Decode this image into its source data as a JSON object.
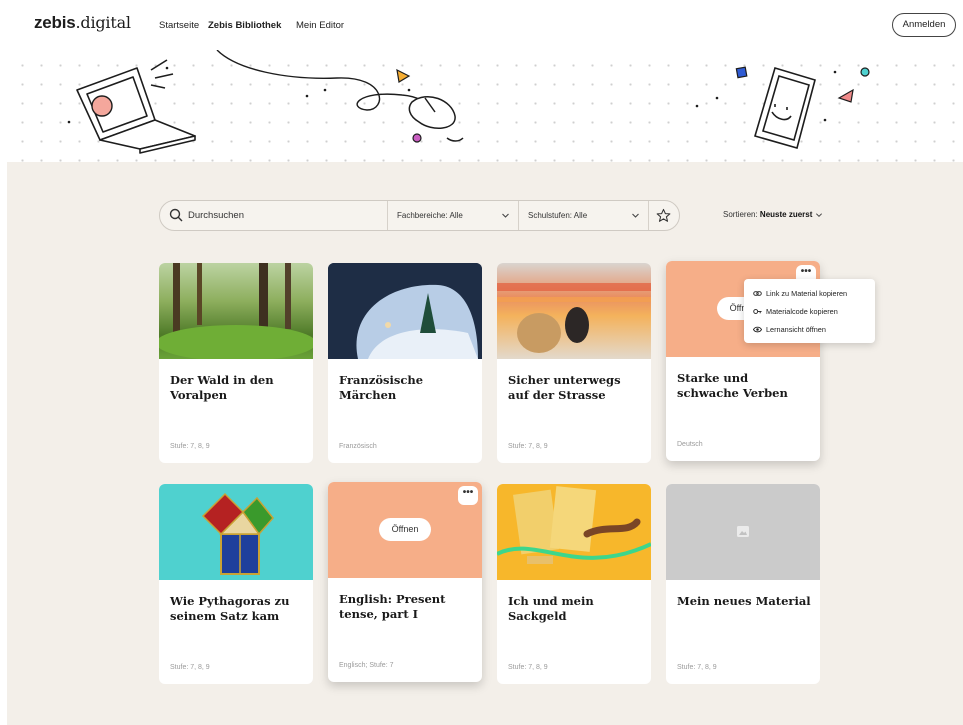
{
  "header": {
    "logo_bold": "zebis",
    "logo_thin": ".digital",
    "nav": [
      "Startseite",
      "Zebis Bibliothek",
      "Mein Editor"
    ],
    "login_label": "Anmelden"
  },
  "toolbar": {
    "search_placeholder": "Durchsuchen",
    "subjects_filter": "Fachbereiche: Alle",
    "levels_filter": "Schulstufen: Alle",
    "sort_label": "Sortieren:",
    "sort_value": "Neuste zuerst"
  },
  "context_menu": {
    "items": [
      {
        "label": "Link zu Material kopieren",
        "icon": "link-icon"
      },
      {
        "label": "Materialcode kopieren",
        "icon": "key-icon"
      },
      {
        "label": "Lernansicht öffnen",
        "icon": "eye-icon"
      }
    ]
  },
  "cards": [
    {
      "title": "Der Wald in den Voralpen",
      "meta": "Stufe: 7, 8, 9"
    },
    {
      "title": "Französische Märchen",
      "meta": "Französisch"
    },
    {
      "title": "Sicher unterwegs auf der Strasse",
      "meta": "Stufe: 7, 8, 9"
    },
    {
      "title": "Starke und schwache Verben",
      "meta": "Deutsch",
      "open_label": "Öffnen"
    },
    {
      "title": "Wie Pythagoras zu seinem Satz kam",
      "meta": "Stufe: 7, 8, 9"
    },
    {
      "title": "English: Present tense, part I",
      "meta": "Englisch; Stufe: 7",
      "open_label": "Öffnen"
    },
    {
      "title": "Ich und mein Sackgeld",
      "meta": "Stufe: 7, 8, 9"
    },
    {
      "title": "Mein neues Material",
      "meta": "Stufe: 7, 8, 9"
    }
  ],
  "more_label": "•••",
  "colors": {
    "accent_card": "#f6ae88",
    "page_bg": "#f3efe9",
    "teal": "#4fd1cf"
  }
}
